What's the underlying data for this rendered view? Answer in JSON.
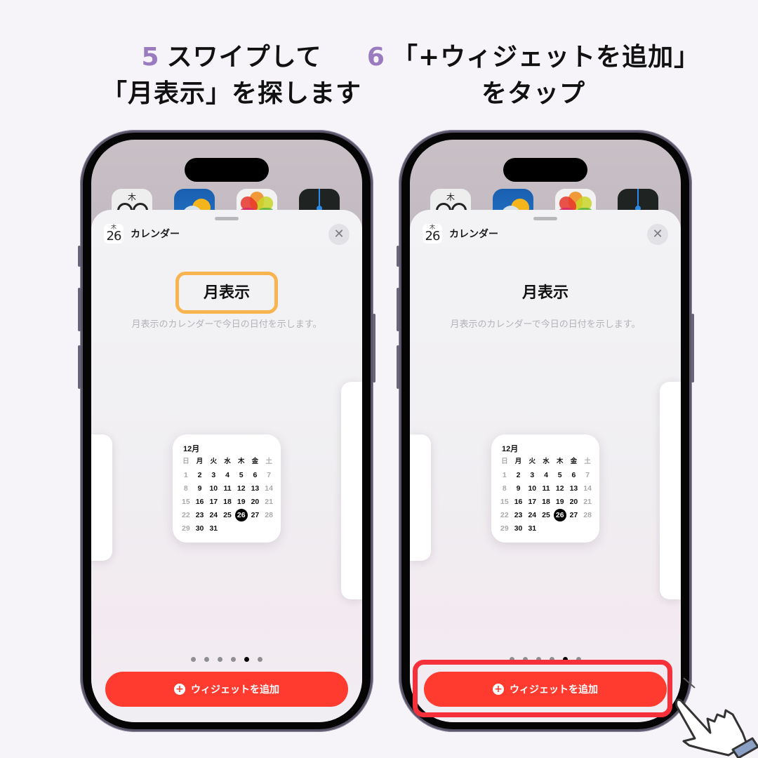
{
  "steps": [
    {
      "number": "5",
      "line1": "スワイプして",
      "line2": "「月表示」を探します"
    },
    {
      "number": "6",
      "line1": "「+ウィジェットを追加」",
      "line2": "をタップ"
    }
  ],
  "home_icons": [
    {
      "name": "calendar-app-icon",
      "dow": "木"
    },
    {
      "name": "weather-app-icon"
    },
    {
      "name": "photos-app-icon"
    },
    {
      "name": "stocks-app-icon"
    }
  ],
  "sheet": {
    "app_icon": {
      "dow": "木",
      "day": "26"
    },
    "app_name": "カレンダー",
    "close_glyph": "✕",
    "widget_title": "月表示",
    "widget_description": "月表示のカレンダーで今日の日付を示します。",
    "page_dots": {
      "count": 6,
      "active_index": 4
    },
    "add_button_label": "ウィジェットを追加",
    "add_button_glyph": "+"
  },
  "calendar": {
    "month": "12月",
    "weekdays": [
      "日",
      "月",
      "火",
      "水",
      "木",
      "金",
      "土"
    ],
    "weeks": [
      [
        "1",
        "2",
        "3",
        "4",
        "5",
        "6",
        "7"
      ],
      [
        "8",
        "9",
        "10",
        "11",
        "12",
        "13",
        "14"
      ],
      [
        "15",
        "16",
        "17",
        "18",
        "19",
        "20",
        "21"
      ],
      [
        "22",
        "23",
        "24",
        "25",
        "26",
        "27",
        "28"
      ],
      [
        "29",
        "30",
        "31",
        "",
        "",
        "",
        ""
      ]
    ],
    "today": "26"
  },
  "colors": {
    "step_number": "#9b7bbf",
    "add_button": "#ff3b30",
    "highlight_orange": "#f7b44f",
    "highlight_red": "#f5303a"
  }
}
